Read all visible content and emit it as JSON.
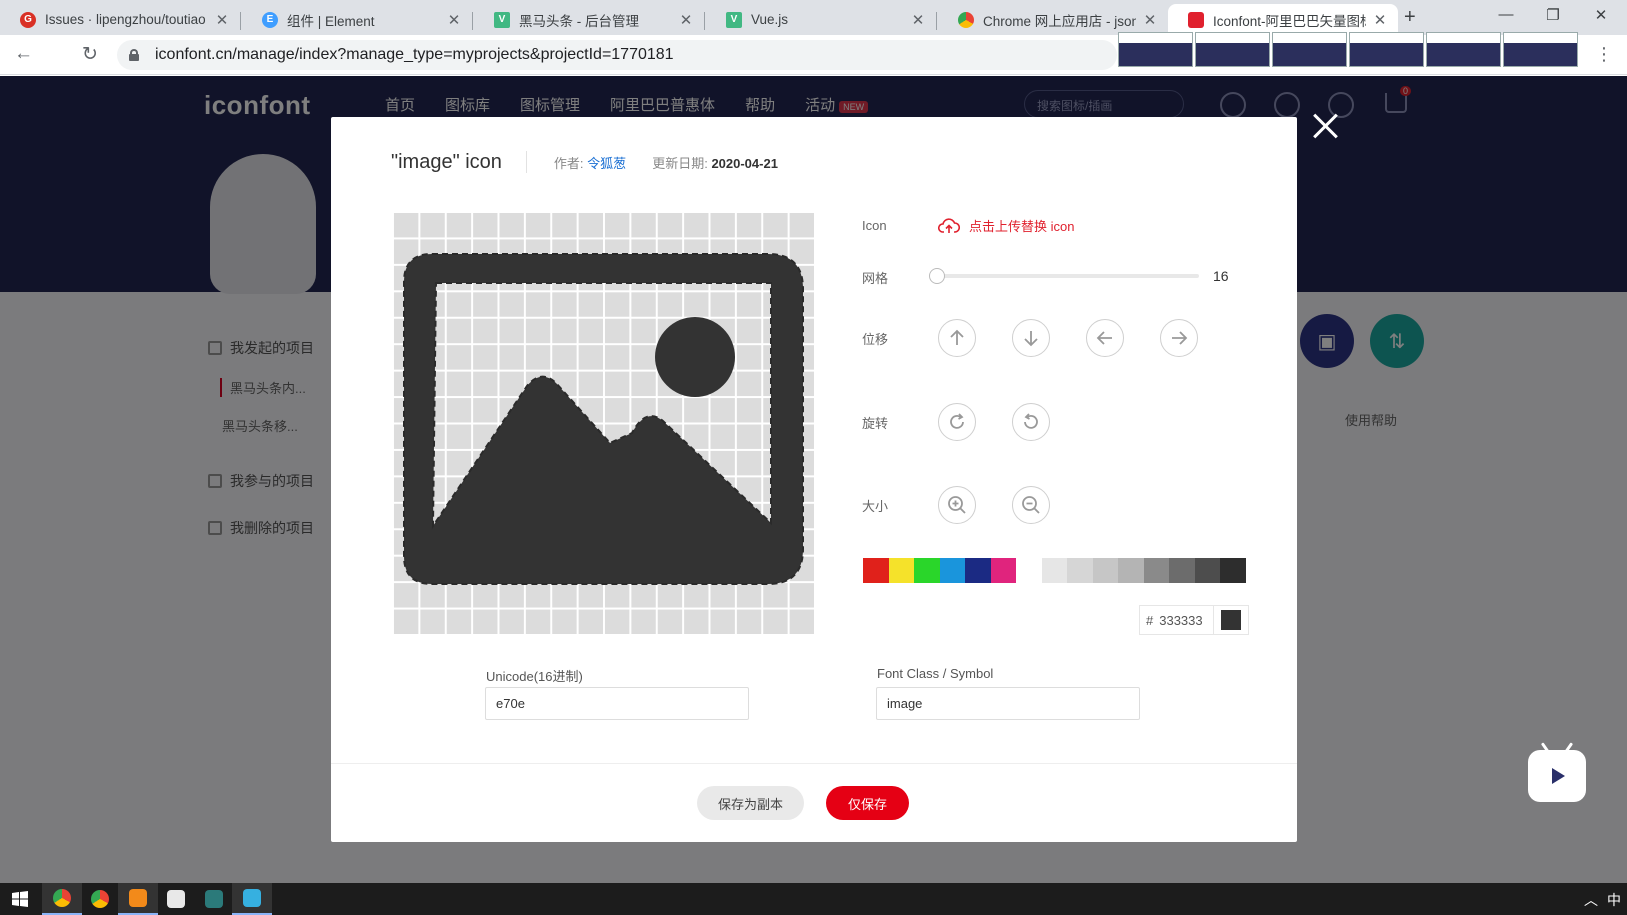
{
  "browser": {
    "tabs": [
      {
        "title": "Issues · lipengzhou/toutiao",
        "favicon": "G"
      },
      {
        "title": "组件 | Element",
        "favicon": "E"
      },
      {
        "title": "黑马头条 - 后台管理",
        "favicon": "V"
      },
      {
        "title": "Vue.js",
        "favicon": "V"
      },
      {
        "title": "Chrome 网上应用店 - json",
        "favicon": ""
      },
      {
        "title": "Iconfont-阿里巴巴矢量图标",
        "favicon": ""
      }
    ],
    "active_tab": 5,
    "new_tab": "+",
    "url": "iconfont.cn/manage/index?manage_type=myprojects&projectId=1770181"
  },
  "page": {
    "brand": "iconfont",
    "nav": [
      "首页",
      "图标库",
      "图标管理",
      "阿里巴巴普惠体",
      "帮助",
      "活动"
    ],
    "nav_badge": "NEW",
    "search_placeholder": "搜索图标/插画",
    "cart_count": "0",
    "sidebar": {
      "my_projects": "我发起的项目",
      "project_active": "黑马头条内...",
      "project_other": "黑马头条移...",
      "joined": "我参与的项目",
      "deleted": "我删除的项目"
    },
    "help": "使用帮助"
  },
  "dialog": {
    "title": "\"image\"  icon",
    "author_label": "作者:",
    "author": "令狐葱",
    "date_label": "更新日期:",
    "date": "2020-04-21",
    "labels": {
      "icon": "Icon",
      "grid": "网格",
      "move": "位移",
      "rotate": "旋转",
      "size": "大小"
    },
    "upload_text": "点击上传替换 icon",
    "grid_value": "16",
    "hash": "#",
    "hex_value": "333333",
    "current_color": "#333333",
    "swatches": [
      "#e0211b",
      "#f5e22a",
      "#2ad62a",
      "#1a95dc",
      "#1b2a83",
      "#e0247d",
      "#ffffff",
      "#e6e6e6",
      "#d6d6d6",
      "#c6c6c6",
      "#b4b4b4",
      "#8a8a8a",
      "#6c6c6c",
      "#4d4d4d",
      "#2d2d2d"
    ],
    "unicode_label": "Unicode(16进制)",
    "unicode_value": "e70e",
    "font_class_label": "Font Class / Symbol",
    "font_class_value": "image",
    "btn_copy": "保存为副本",
    "btn_save": "仅保存"
  },
  "taskbar": {
    "ime": "中"
  }
}
